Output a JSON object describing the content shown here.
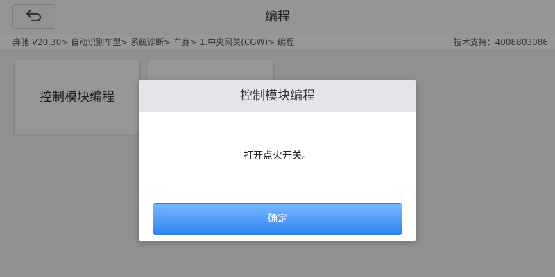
{
  "header": {
    "title": "编程"
  },
  "icons": {
    "back": "back-arrow-icon"
  },
  "breadcrumb": {
    "path": "奔驰 V20.30> 自动识别车型> 系统诊断> 车身> 1.中央网关(CGW)> 编程",
    "support": "技术支持：4008803086"
  },
  "tiles": [
    {
      "label": "控制模块编程"
    },
    {
      "label": ""
    }
  ],
  "dialog": {
    "title": "控制模块编程",
    "message": "打开点火开关。",
    "ok_label": "确定"
  },
  "colors": {
    "accent": "#2f86f0",
    "header_bg": "#f1f1f1",
    "dialog_header_bg": "#e3e5e8"
  }
}
